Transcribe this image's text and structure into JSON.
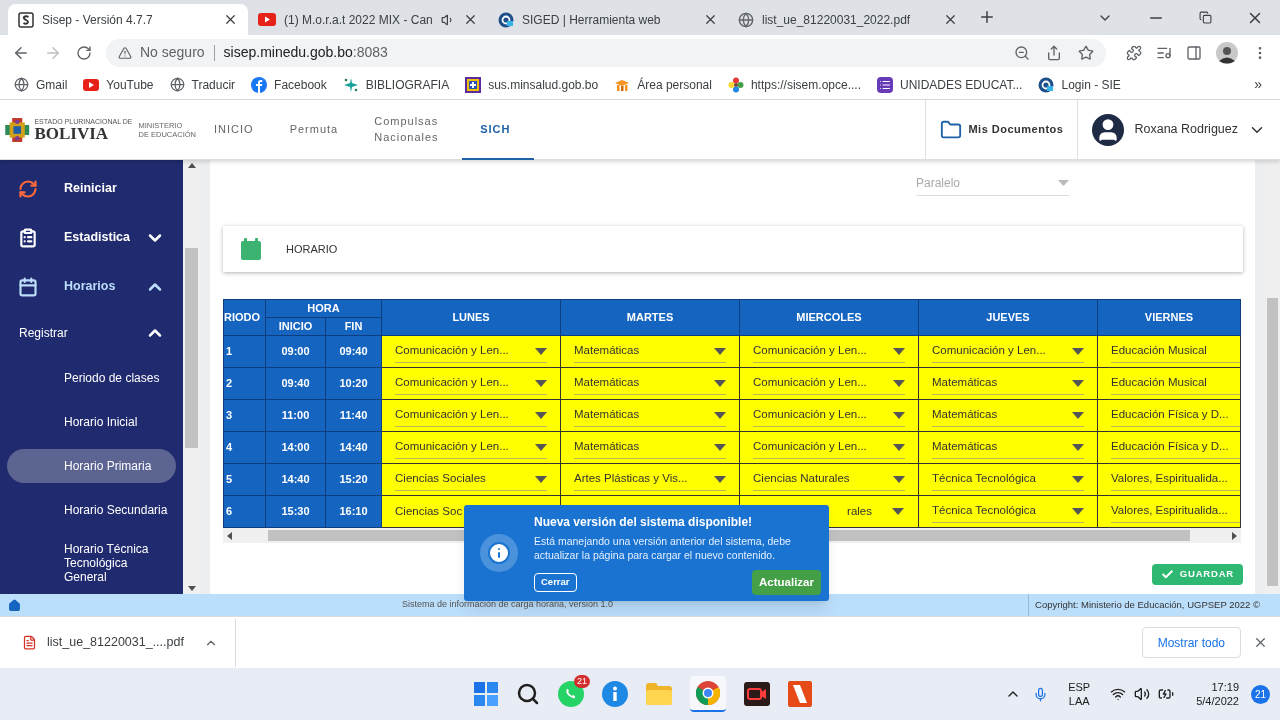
{
  "browser": {
    "tabs": [
      {
        "title": "Sisep - Versión 4.7.7",
        "selected": true,
        "audio": false
      },
      {
        "title": "(1) M.o.r.a.t 2022 MIX - Can",
        "selected": false,
        "audio": true
      },
      {
        "title": "SIGED | Herramienta web",
        "selected": false,
        "audio": false
      },
      {
        "title": "list_ue_81220031_2022.pdf",
        "selected": false,
        "audio": false
      }
    ],
    "address": {
      "security": "No seguro",
      "host": "sisep.minedu.gob.bo",
      "port": ":8083"
    },
    "bookmarks": [
      "Gmail",
      "YouTube",
      "Traducir",
      "Facebook",
      "BIBLIOGRAFIA",
      "sus.minsalud.gob.bo",
      "Área personal",
      "https://sisem.opce....",
      "UNIDADES EDUCAT...",
      "Login - SIE"
    ],
    "bookmarks_more": "»"
  },
  "app": {
    "logo": {
      "state": "ESTADO PLURINACIONAL DE",
      "country": "BOLIVIA",
      "ministry": [
        "MINISTERIO",
        "DE EDUCACIÓN"
      ]
    },
    "nav": [
      {
        "label": "INICIO",
        "selected": false
      },
      {
        "label": "Permuta",
        "selected": false
      },
      {
        "label": "Compulsas Nacionales",
        "selected": false
      },
      {
        "label": "SICH",
        "selected": true
      }
    ],
    "documents": "Mis Documentos",
    "user": "Roxana Rodriguez",
    "sidebar": [
      {
        "label": "Reiniciar",
        "kind": "action"
      },
      {
        "label": "Estadistica",
        "kind": "group",
        "expanded": false
      },
      {
        "label": "Horarios",
        "kind": "group",
        "expanded": true,
        "children": [
          {
            "label": "Registrar",
            "kind": "subgroup",
            "expanded": true,
            "children": [
              {
                "label": "Periodo de clases",
                "selected": false
              },
              {
                "label": "Horario Inicial",
                "selected": false
              },
              {
                "label": "Horario Primaria",
                "selected": true
              },
              {
                "label": "Horario Secundaria",
                "selected": false
              },
              {
                "label": "Horario Técnica Tecnológica General",
                "selected": false
              }
            ]
          }
        ]
      }
    ],
    "paralelo": {
      "placeholder": "Paralelo"
    },
    "section_title": "HORARIO",
    "table": {
      "period": "RIODO",
      "hora": "HORA",
      "start": "INICIO",
      "end": "FIN",
      "days": [
        "LUNES",
        "MARTES",
        "MIERCOLES",
        "JUEVES",
        "VIERNES"
      ],
      "rows": [
        {
          "period": "1",
          "start": "09:00",
          "end": "09:40",
          "cells": [
            {
              "kind": "select",
              "text": "Comunicación y Len..."
            },
            {
              "kind": "select",
              "text": "Matemáticas"
            },
            {
              "kind": "select",
              "text": "Comunicación y Len..."
            },
            {
              "kind": "select",
              "text": "Comunicación y Len..."
            },
            {
              "kind": "text",
              "text": "Educación Musical"
            }
          ]
        },
        {
          "period": "2",
          "start": "09:40",
          "end": "10:20",
          "cells": [
            {
              "kind": "select",
              "text": "Comunicación y Len..."
            },
            {
              "kind": "select",
              "text": "Matemáticas"
            },
            {
              "kind": "select",
              "text": "Comunicación y Len..."
            },
            {
              "kind": "select",
              "text": "Matemáticas"
            },
            {
              "kind": "text",
              "text": "Educación Musical"
            }
          ]
        },
        {
          "period": "3",
          "start": "11:00",
          "end": "11:40",
          "cells": [
            {
              "kind": "select",
              "text": "Comunicación y Len..."
            },
            {
              "kind": "select",
              "text": "Matemáticas"
            },
            {
              "kind": "select",
              "text": "Comunicación y Len..."
            },
            {
              "kind": "select",
              "text": "Matemáticas"
            },
            {
              "kind": "text",
              "text": "Educación Física y D..."
            }
          ]
        },
        {
          "period": "4",
          "start": "14:00",
          "end": "14:40",
          "cells": [
            {
              "kind": "select",
              "text": "Comunicación y Len..."
            },
            {
              "kind": "select",
              "text": "Matemáticas"
            },
            {
              "kind": "select",
              "text": "Comunicación y Len..."
            },
            {
              "kind": "select",
              "text": "Matemáticas"
            },
            {
              "kind": "text",
              "text": "Educación Física y D..."
            }
          ]
        },
        {
          "period": "5",
          "start": "14:40",
          "end": "15:20",
          "cells": [
            {
              "kind": "select",
              "text": "Ciencias Sociales"
            },
            {
              "kind": "select",
              "text": "Artes Plásticas y Vis..."
            },
            {
              "kind": "select",
              "text": "Ciencias Naturales"
            },
            {
              "kind": "select",
              "text": "Técnica Tecnológica"
            },
            {
              "kind": "text",
              "text": "Valores, Espiritualida..."
            }
          ]
        },
        {
          "period": "6",
          "start": "15:30",
          "end": "16:10",
          "cells": [
            {
              "kind": "head",
              "text": "Ciencias Soc"
            },
            {
              "kind": "hidden"
            },
            {
              "kind": "tail",
              "text": "rales"
            },
            {
              "kind": "select",
              "text": "Técnica Tecnológica"
            },
            {
              "kind": "text",
              "text": "Valores, Espiritualida..."
            }
          ]
        }
      ]
    },
    "save": "GUARDAR",
    "popup": {
      "title": "Nueva versión del sistema disponible!",
      "message": "Está manejando una versión anterior del sistema, debe actualizar la página para cargar el nuevo contenido.",
      "close": "Cerrar",
      "update": "Actualizar"
    },
    "footer": {
      "system": "Sistema de información de carga horaria, versión 1.0",
      "copyright": "Copyright: Ministerio de Educación, UGPSEP 2022 ©"
    }
  },
  "downloads": {
    "file": "list_ue_81220031_....pdf",
    "show_all": "Mostrar todo"
  },
  "taskbar": {
    "whatsapp_badge": "21",
    "language": [
      "ESP",
      "LAA"
    ],
    "time": "17:19",
    "date": "5/4/2022",
    "notifications": "21"
  }
}
